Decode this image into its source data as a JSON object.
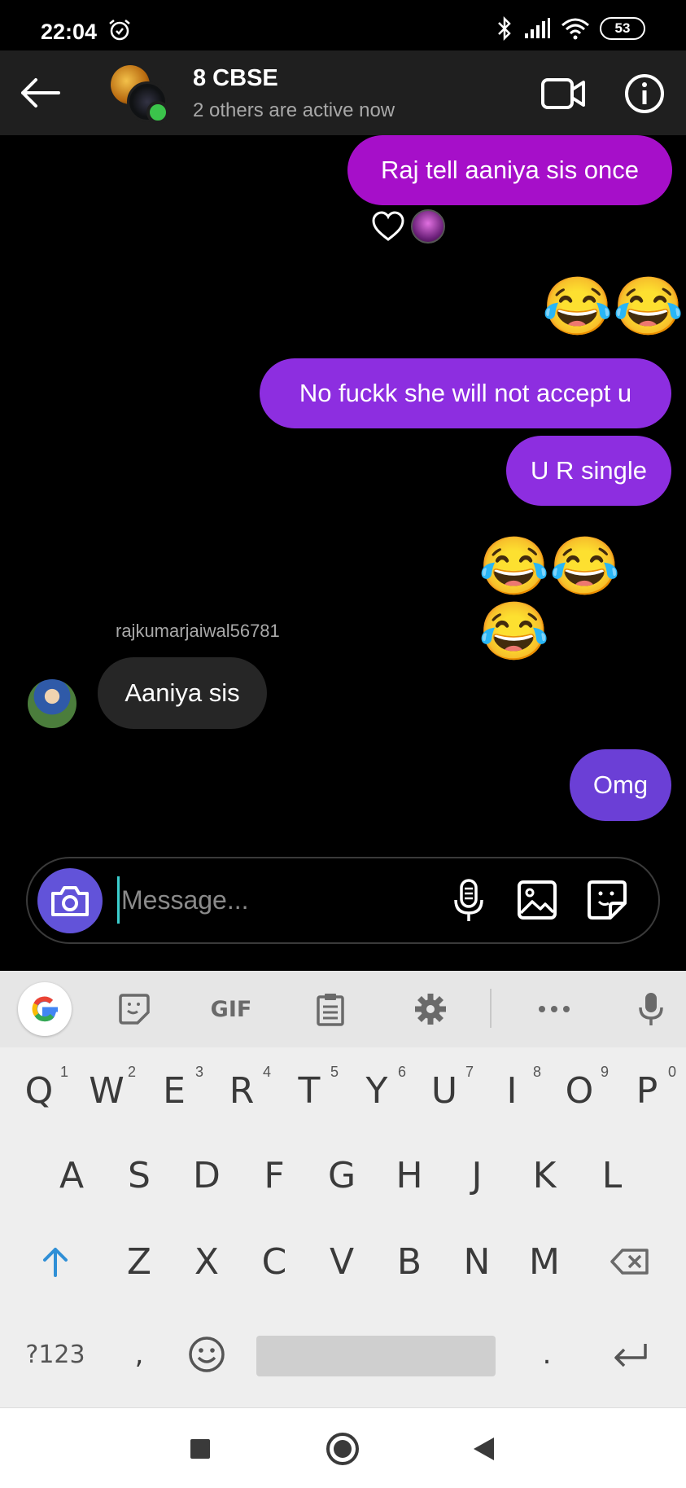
{
  "status_bar": {
    "time": "22:04",
    "battery": "53"
  },
  "header": {
    "title": "8 CBSE",
    "subtitle": "2 others are active now"
  },
  "messages": {
    "m1": "Raj tell aaniya sis once",
    "m2_emoji": "😂😂",
    "m3": "No fuckk she will not accept u",
    "m4": "U R single",
    "m5_emoji": "😂😂😂",
    "sender_name": "rajkumarjaiwal56781",
    "m6": "Aaniya sis",
    "m7": "Omg"
  },
  "composer": {
    "placeholder": "Message..."
  },
  "keyboard": {
    "toolbar": {
      "gif": "GIF"
    },
    "row1": [
      {
        "k": "Q",
        "h": "1"
      },
      {
        "k": "W",
        "h": "2"
      },
      {
        "k": "E",
        "h": "3"
      },
      {
        "k": "R",
        "h": "4"
      },
      {
        "k": "T",
        "h": "5"
      },
      {
        "k": "Y",
        "h": "6"
      },
      {
        "k": "U",
        "h": "7"
      },
      {
        "k": "I",
        "h": "8"
      },
      {
        "k": "O",
        "h": "9"
      },
      {
        "k": "P",
        "h": "0"
      }
    ],
    "row2": [
      "A",
      "S",
      "D",
      "F",
      "G",
      "H",
      "J",
      "K",
      "L"
    ],
    "row3": [
      "Z",
      "X",
      "C",
      "V",
      "B",
      "N",
      "M"
    ],
    "symbols": "?123",
    "comma": ",",
    "period": "."
  },
  "colors": {
    "bubble_purple": "#8d2ee0",
    "bubble_magenta": "#a60fc9",
    "bubble_violet": "#6b3fd6",
    "camera_button": "#6253d9",
    "online_dot": "#3bc44b"
  }
}
